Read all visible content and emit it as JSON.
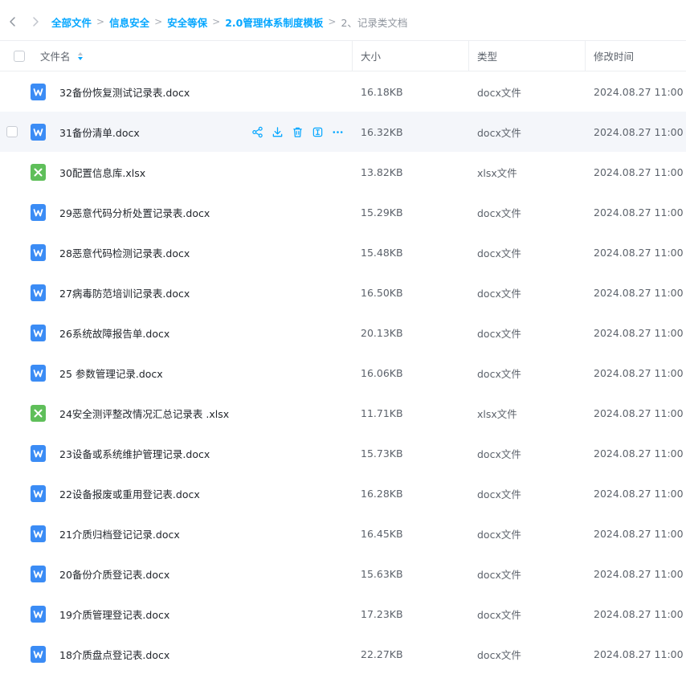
{
  "nav": {
    "back_icon": "chevron-left-icon",
    "forward_icon": "chevron-right-icon"
  },
  "breadcrumb": [
    {
      "label": "全部文件",
      "current": false
    },
    {
      "label": "信息安全",
      "current": false
    },
    {
      "label": "安全等保",
      "current": false
    },
    {
      "label": "2.0管理体系制度模板",
      "current": false
    },
    {
      "label": "2、记录类文档",
      "current": true
    }
  ],
  "breadcrumb_separator": ">",
  "columns": {
    "name": "文件名",
    "size": "大小",
    "type": "类型",
    "modified": "修改时间"
  },
  "colors": {
    "accent": "#06a7ff",
    "docx_icon": "#3b8cf5",
    "xlsx_icon": "#5fbf5a",
    "row_hover": "#f4f6fa"
  },
  "hovered_row_actions": [
    "share-icon",
    "download-icon",
    "delete-icon",
    "rename-icon",
    "more-icon"
  ],
  "files": [
    {
      "name": "32备份恢复测试记录表.docx",
      "kind": "docx",
      "size": "16.18KB",
      "type": "docx文件",
      "modified": "2024.08.27 11:00",
      "hover": false
    },
    {
      "name": "31备份清单.docx",
      "kind": "docx",
      "size": "16.32KB",
      "type": "docx文件",
      "modified": "2024.08.27 11:00",
      "hover": true
    },
    {
      "name": "30配置信息库.xlsx",
      "kind": "xlsx",
      "size": "13.82KB",
      "type": "xlsx文件",
      "modified": "2024.08.27 11:00",
      "hover": false
    },
    {
      "name": "29恶意代码分析处置记录表.docx",
      "kind": "docx",
      "size": "15.29KB",
      "type": "docx文件",
      "modified": "2024.08.27 11:00",
      "hover": false
    },
    {
      "name": "28恶意代码检测记录表.docx",
      "kind": "docx",
      "size": "15.48KB",
      "type": "docx文件",
      "modified": "2024.08.27 11:00",
      "hover": false
    },
    {
      "name": "27病毒防范培训记录表.docx",
      "kind": "docx",
      "size": "16.50KB",
      "type": "docx文件",
      "modified": "2024.08.27 11:00",
      "hover": false
    },
    {
      "name": "26系统故障报告单.docx",
      "kind": "docx",
      "size": "20.13KB",
      "type": "docx文件",
      "modified": "2024.08.27 11:00",
      "hover": false
    },
    {
      "name": "25 参数管理记录.docx",
      "kind": "docx",
      "size": "16.06KB",
      "type": "docx文件",
      "modified": "2024.08.27 11:00",
      "hover": false
    },
    {
      "name": "24安全测评整改情况汇总记录表 .xlsx",
      "kind": "xlsx",
      "size": "11.71KB",
      "type": "xlsx文件",
      "modified": "2024.08.27 11:00",
      "hover": false
    },
    {
      "name": "23设备或系统维护管理记录.docx",
      "kind": "docx",
      "size": "15.73KB",
      "type": "docx文件",
      "modified": "2024.08.27 11:00",
      "hover": false
    },
    {
      "name": "22设备报废或重用登记表.docx",
      "kind": "docx",
      "size": "16.28KB",
      "type": "docx文件",
      "modified": "2024.08.27 11:00",
      "hover": false
    },
    {
      "name": "21介质归档登记记录.docx",
      "kind": "docx",
      "size": "16.45KB",
      "type": "docx文件",
      "modified": "2024.08.27 11:00",
      "hover": false
    },
    {
      "name": "20备份介质登记表.docx",
      "kind": "docx",
      "size": "15.63KB",
      "type": "docx文件",
      "modified": "2024.08.27 11:00",
      "hover": false
    },
    {
      "name": "19介质管理登记表.docx",
      "kind": "docx",
      "size": "17.23KB",
      "type": "docx文件",
      "modified": "2024.08.27 11:00",
      "hover": false
    },
    {
      "name": "18介质盘点登记表.docx",
      "kind": "docx",
      "size": "22.27KB",
      "type": "docx文件",
      "modified": "2024.08.27 11:00",
      "hover": false
    }
  ]
}
